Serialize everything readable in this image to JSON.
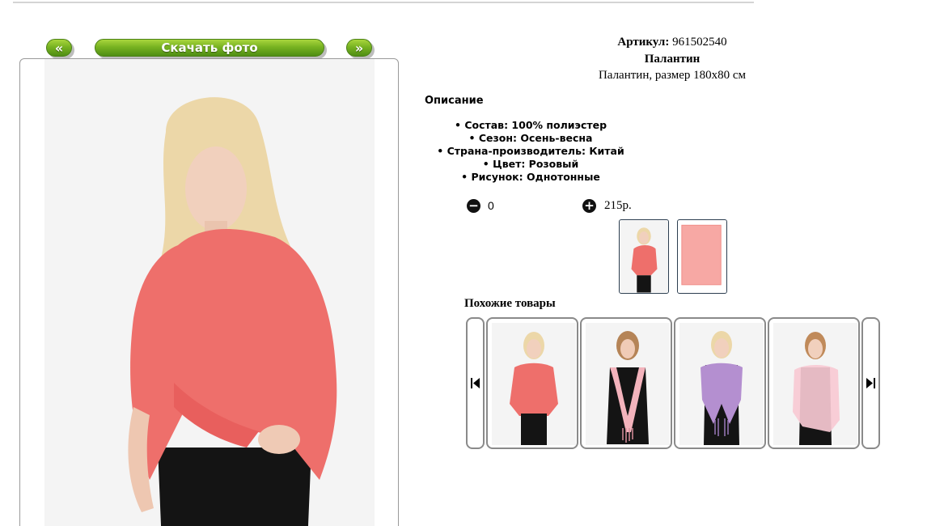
{
  "nav": {
    "prev_label": "«",
    "download_label": "Скачать фото",
    "next_label": "»"
  },
  "product": {
    "article_label": "Артикул:",
    "article_value": "961502540",
    "name": "Палантин",
    "description": "Палантин, размер 180х80 см"
  },
  "description": {
    "heading": "Описание",
    "features": [
      "Состав: 100% полиэстер",
      "Сезон: Осень-весна",
      "Страна-производитель: Китай",
      "Цвет: Розовый",
      "Рисунок: Однотонные"
    ]
  },
  "order": {
    "quantity": "0",
    "price": "215р."
  },
  "similar": {
    "heading": "Похожие товары"
  },
  "colors": {
    "button_green": "#6aa51d",
    "scarf_coral": "#ee6f6b",
    "scarf_pink": "#f3b3bc",
    "scarf_lilac": "#b48fd0"
  }
}
